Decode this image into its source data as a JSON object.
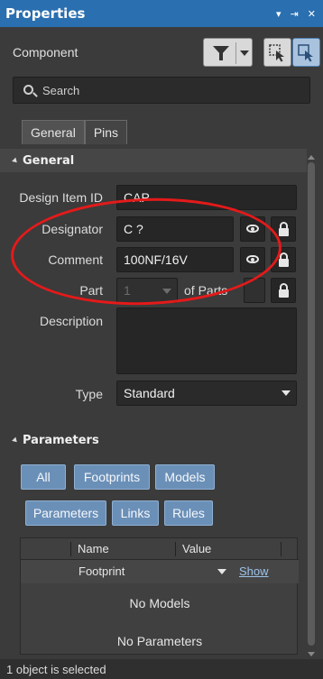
{
  "panel": {
    "title": "Properties",
    "title_icons": [
      "▾",
      "⇥",
      "✕"
    ]
  },
  "header": {
    "object_type": "Component"
  },
  "search": {
    "placeholder": "Search"
  },
  "tabs": [
    {
      "label": "General",
      "active": true
    },
    {
      "label": "Pins",
      "active": false
    }
  ],
  "general": {
    "section_title": "General",
    "design_item_id": {
      "label": "Design Item ID",
      "value": "CAP"
    },
    "designator": {
      "label": "Designator",
      "value": "C ?"
    },
    "comment": {
      "label": "Comment",
      "value": "100NF/16V"
    },
    "part": {
      "label": "Part",
      "value": "1",
      "of_parts_label": "of Parts"
    },
    "description": {
      "label": "Description",
      "value": ""
    },
    "type": {
      "label": "Type",
      "value": "Standard"
    }
  },
  "parameters": {
    "section_title": "Parameters",
    "filter_buttons_row1": [
      "All",
      "Footprints",
      "Models"
    ],
    "filter_buttons_row2": [
      "Parameters",
      "Links",
      "Rules"
    ],
    "columns": [
      "Name",
      "Value"
    ],
    "rows": [
      {
        "name": "Footprint",
        "action": "Show"
      }
    ],
    "no_models_text": "No Models",
    "no_parameters_text": "No Parameters"
  },
  "status": {
    "text": "1 object is selected"
  },
  "colors": {
    "title_bar": "#2a6fb0",
    "accent_button": "#6b90b8",
    "annotation_circle": "#e41a1a"
  }
}
